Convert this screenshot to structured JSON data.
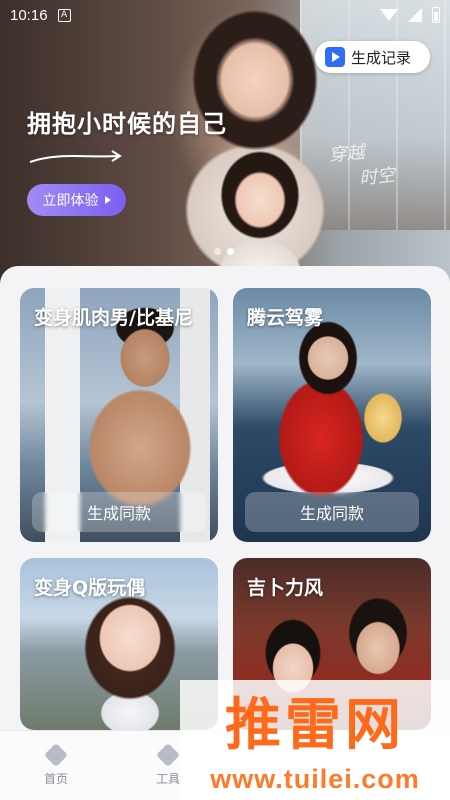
{
  "status_bar": {
    "time": "10:16",
    "notification_icon": "A"
  },
  "hero": {
    "title": "拥抱小时候的自己",
    "cta_label": "立即体验",
    "history_label": "生成记录",
    "deco_line1": "穿越",
    "deco_line2": "时空",
    "active_slide": 2,
    "slide_count": 2
  },
  "cards": [
    {
      "title": "变身肌肉男/比基尼",
      "button": "生成同款"
    },
    {
      "title": "腾云驾雾",
      "button": "生成同款"
    },
    {
      "title": "变身Q版玩偶"
    },
    {
      "title": "吉卜力风"
    }
  ],
  "bottom_nav": [
    {
      "label": "首页",
      "icon": "home-icon"
    },
    {
      "label": "工具",
      "icon": "tools-icon"
    }
  ],
  "watermark": {
    "brand": "推雷网",
    "url": "www.tuilei.com"
  },
  "colors": {
    "accent": "#7a5ff0",
    "history_icon": "#2f6df6",
    "watermark": "#ff6a1a"
  }
}
